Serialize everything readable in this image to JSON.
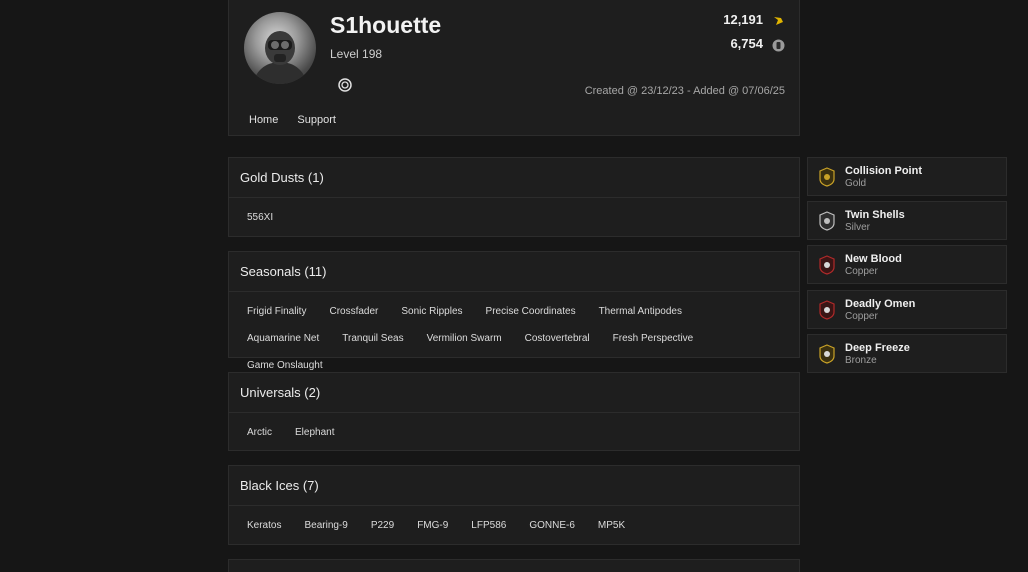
{
  "profile": {
    "username": "S1houette",
    "level": "Level 198",
    "renown": "12,191",
    "credits": "6,754",
    "created": "Created @ 23/12/23 - Added @ 07/06/25",
    "nav": [
      "Home",
      "Support"
    ]
  },
  "sections": [
    {
      "title": "Gold Dusts (1)",
      "items": [
        "556XI"
      ]
    },
    {
      "title": "Seasonals (11)",
      "items": [
        "Frigid Finality",
        "Crossfader",
        "Sonic Ripples",
        "Precise Coordinates",
        "Thermal Antipodes",
        "Aquamarine Net",
        "Tranquil Seas",
        "Vermilion Swarm",
        "Costovertebral",
        "Fresh Perspective",
        "Game Onslaught"
      ]
    },
    {
      "title": "Universals (2)",
      "items": [
        "Arctic",
        "Elephant"
      ]
    },
    {
      "title": "Black Ices (7)",
      "items": [
        "Keratos",
        "Bearing-9",
        "P229",
        "FMG-9",
        "LFP586",
        "GONNE-6",
        "MP5K"
      ]
    }
  ],
  "charms": [
    {
      "name": "Collision Point",
      "tier": "Gold",
      "color": "#c9a227"
    },
    {
      "name": "Twin Shells",
      "tier": "Silver",
      "color": "#bfbfbf"
    },
    {
      "name": "New Blood",
      "tier": "Copper",
      "color": "#b02a2a"
    },
    {
      "name": "Deadly Omen",
      "tier": "Copper",
      "color": "#b02a2a"
    },
    {
      "name": "Deep Freeze",
      "tier": "Bronze",
      "color": "#c9a227"
    }
  ],
  "colors": {
    "background": "#161616",
    "panel": "#1e1e1e",
    "border": "#2c2c2c",
    "renown_icon": "#e0b400"
  }
}
